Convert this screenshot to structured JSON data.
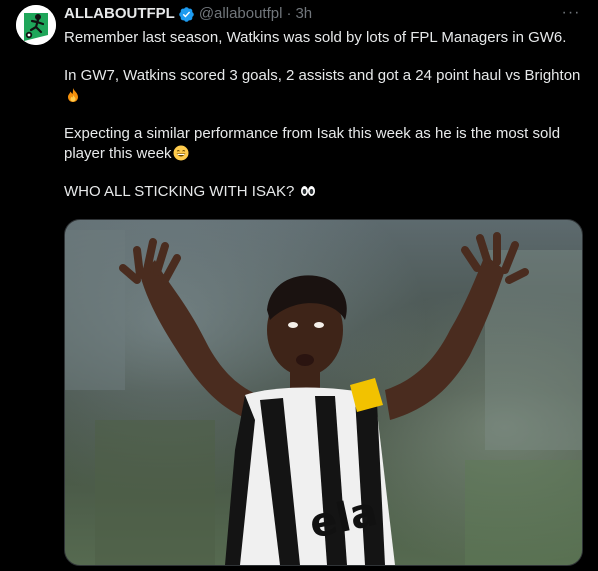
{
  "tweet": {
    "display_name": "ALLABOUTFPL",
    "handle": "@allaboutfpl",
    "separator": "·",
    "time": "3h",
    "more_label": "···",
    "paragraphs": [
      {
        "text": "Remember last season, Watkins was sold by lots of FPL Managers in GW6.",
        "emoji": ""
      },
      {
        "text": "In GW7, Watkins scored 3 goals, 2 assists and got a 24 point haul vs Brighton",
        "emoji": "fire-emoji"
      },
      {
        "text": "Expecting a similar performance from Isak this week as he is the most sold player this week",
        "emoji": "grin-emoji"
      },
      {
        "text": "WHO ALL STICKING WITH ISAK? ",
        "emoji": "eyes-emoji"
      }
    ],
    "media_text": "ela"
  },
  "colors": {
    "background": "#000000",
    "text": "#e7e9ea",
    "muted": "#71767b",
    "verified": "#1d9bf0",
    "brand_green": "#1fa65a"
  },
  "icons": {
    "verified": "verified-badge-icon",
    "more": "more-horizontal-icon"
  }
}
